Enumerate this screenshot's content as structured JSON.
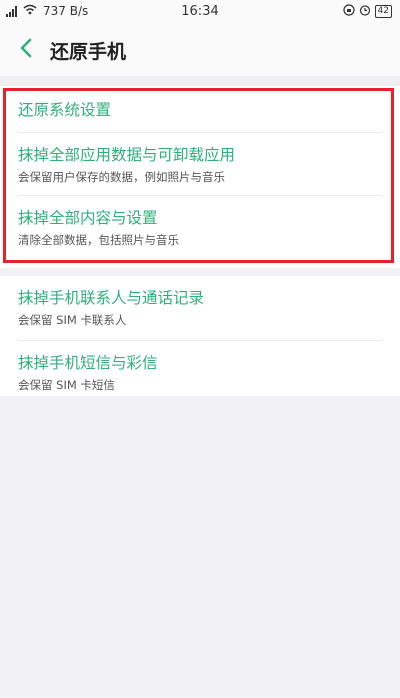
{
  "status_bar": {
    "network_speed": "737 B/s",
    "time": "16:34",
    "battery": "42"
  },
  "header": {
    "title": "还原手机"
  },
  "group1": {
    "items": [
      {
        "label": "还原系统设置",
        "sub": ""
      },
      {
        "label": "抹掉全部应用数据与可卸载应用",
        "sub": "会保留用户保存的数据，例如照片与音乐"
      },
      {
        "label": "抹掉全部内容与设置",
        "sub": "清除全部数据，包括照片与音乐"
      }
    ]
  },
  "group2": {
    "items": [
      {
        "label": "抹掉手机联系人与通话记录",
        "sub": "会保留 SIM 卡联系人"
      },
      {
        "label": "抹掉手机短信与彩信",
        "sub": "会保留 SIM 卡短信"
      }
    ]
  },
  "colors": {
    "accent": "#2fb07a",
    "highlight_box": "#e8202a"
  }
}
